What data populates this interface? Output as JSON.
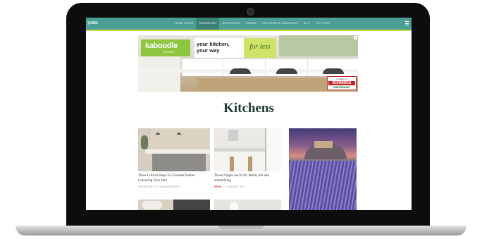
{
  "nav": {
    "logo": "yates",
    "items": [
      "HOME TOURS",
      "RENOVATING",
      "DECORATING",
      "ROOMS",
      "OUTDOORS & GARDENING",
      "DIYS",
      "GIFT SHOP"
    ],
    "active_index": 1
  },
  "ad": {
    "brand": "kaboodle",
    "brand_sub": "KITCHEN",
    "headline_line1": "your kitchen,",
    "headline_line2": "your way",
    "tagline": "for less",
    "badge_line1": "Available at",
    "badge_line2": "BUNNINGS",
    "badge_line3": "warehouse",
    "choices_icon": "adchoices-icon"
  },
  "page": {
    "title": "Kitchens"
  },
  "cards": [
    {
      "title": "Three Critical Steps To Consider Before Colouring Your Hair",
      "meta": "SPONSORED BY SCHWARZKOPF"
    },
    {
      "tag": "RENO",
      "title": "These fridges are fit for family life and entertaining",
      "date": "7 JANUARY 2021"
    }
  ],
  "colors": {
    "nav": "#4b9e93",
    "nav_active": "#3a8176",
    "accent_bar": "#c8d64a",
    "title": "#1d3b35",
    "brand_green": "#8ec63f",
    "tag_red": "#c2332f"
  }
}
